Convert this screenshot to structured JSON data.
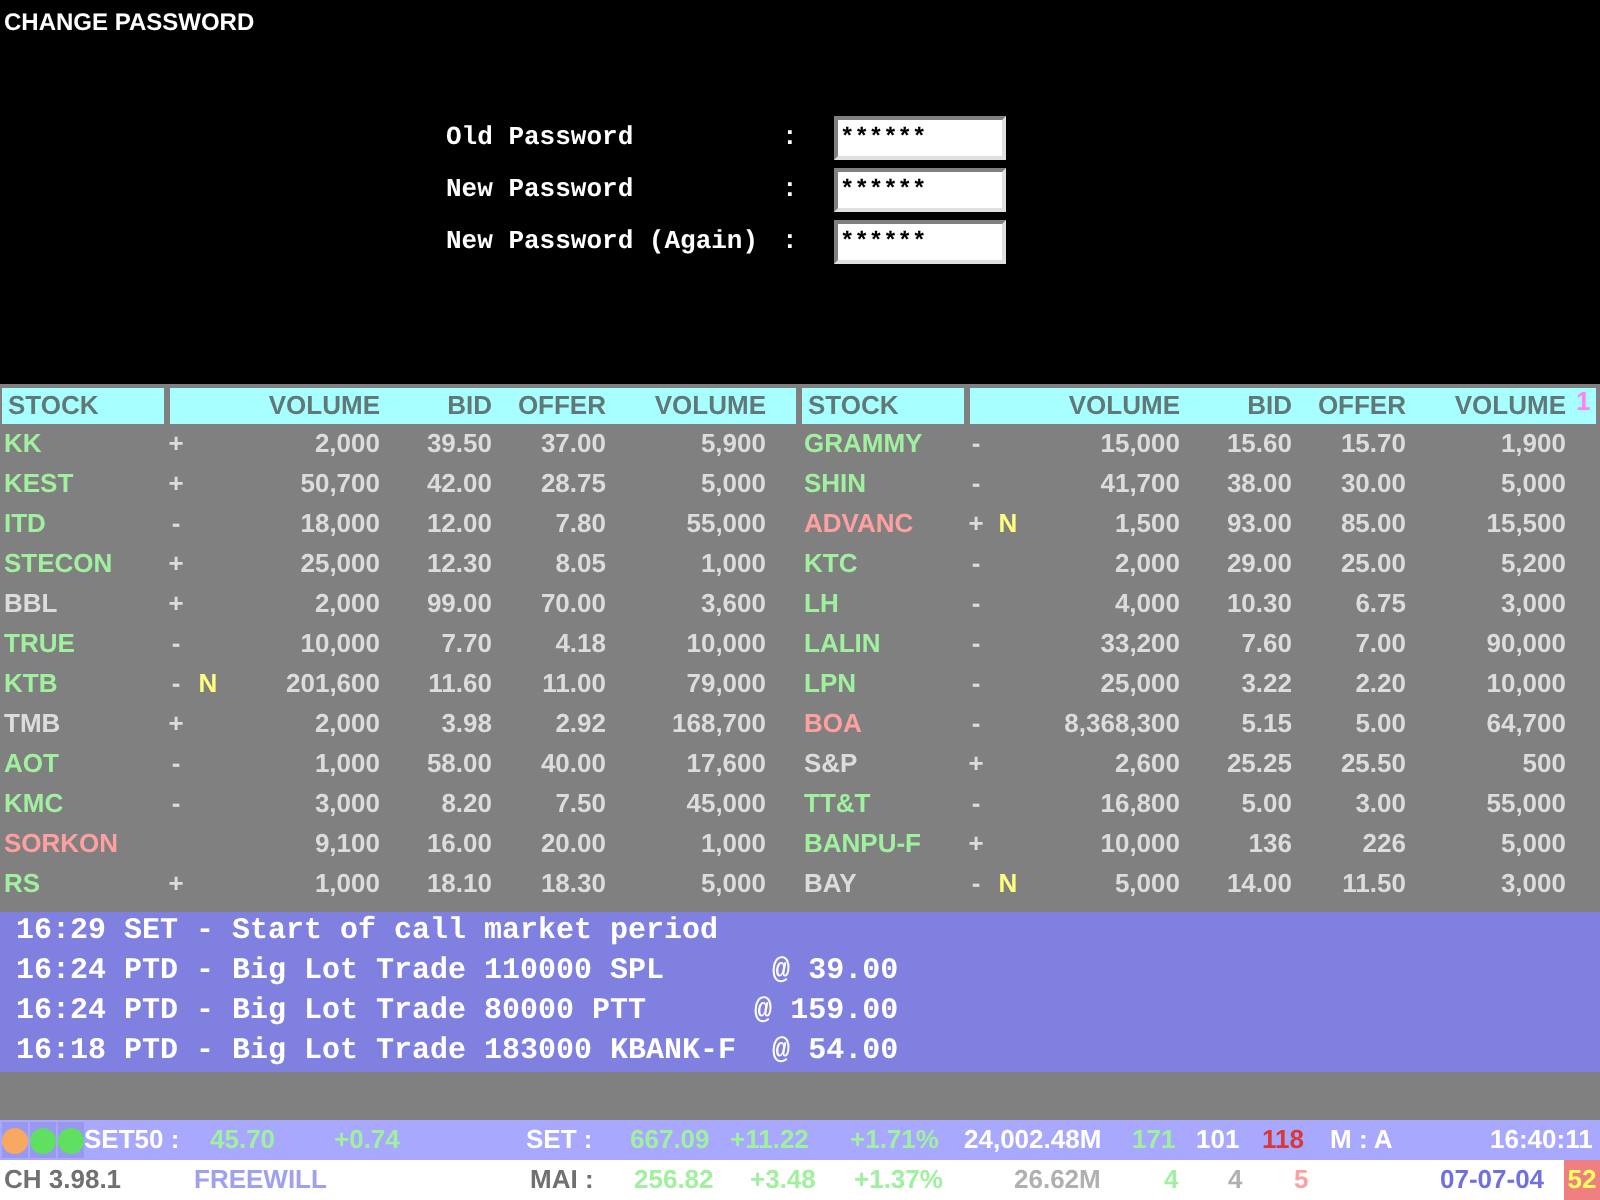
{
  "title": "CHANGE PASSWORD",
  "form": [
    {
      "label": "Old Password",
      "colon": ":",
      "value": "******"
    },
    {
      "label": "New Password",
      "colon": ":",
      "value": "******"
    },
    {
      "label": "New Password (Again)",
      "colon": ":",
      "value": "******"
    }
  ],
  "tables": [
    {
      "columns": [
        "STOCK",
        "VOLUME",
        "BID",
        "OFFER",
        "VOLUME"
      ],
      "rows": [
        {
          "stock": "KK",
          "color": "#a0f0a0",
          "change": "+",
          "volume_1": "2,000",
          "bid": "39.50",
          "offer": "37.00",
          "volume_2": "5,900"
        },
        {
          "stock": "KEST",
          "color": "#a0f0a0",
          "change": "+",
          "volume_1": "50,700",
          "bid": "42.00",
          "offer": "28.75",
          "volume_2": "5,000"
        },
        {
          "stock": "ITD",
          "color": "#a0f0a0",
          "change": "-",
          "volume_1": "18,000",
          "bid": "12.00",
          "offer": "7.80",
          "volume_2": "55,000"
        },
        {
          "stock": "STECON",
          "color": "#a0f0a0",
          "change": "+",
          "volume_1": "25,000",
          "bid": "12.30",
          "offer": "8.05",
          "volume_2": "1,000"
        },
        {
          "stock": "BBL",
          "color": "#dcdcdc",
          "change": "+",
          "volume_1": "2,000",
          "bid": "99.00",
          "offer": "70.00",
          "volume_2": "3,600"
        },
        {
          "stock": "TRUE",
          "color": "#a0f0a0",
          "change": "-",
          "volume_1": "10,000",
          "bid": "7.70",
          "offer": "4.18",
          "volume_2": "10,000"
        },
        {
          "stock": "KTB",
          "color": "#a0f0a0",
          "change": "-",
          "flag": "N",
          "volume_1": "201,600",
          "bid": "11.60",
          "offer": "11.00",
          "volume_2": "79,000"
        },
        {
          "stock": "TMB",
          "color": "#dcdcdc",
          "change": "+",
          "volume_1": "2,000",
          "bid": "3.98",
          "offer": "2.92",
          "volume_2": "168,700"
        },
        {
          "stock": "AOT",
          "color": "#a0f0a0",
          "change": "-",
          "volume_1": "1,000",
          "bid": "58.00",
          "offer": "40.00",
          "volume_2": "17,600"
        },
        {
          "stock": "KMC",
          "color": "#a0f0a0",
          "change": "-",
          "volume_1": "3,000",
          "bid": "8.20",
          "offer": "7.50",
          "volume_2": "45,000"
        },
        {
          "stock": "SORKON",
          "color": "#ffa0a0",
          "volume_1": "9,100",
          "bid": "16.00",
          "offer": "20.00",
          "volume_2": "1,000"
        },
        {
          "stock": "RS",
          "color": "#a0f0a0",
          "change": "+",
          "volume_1": "1,000",
          "bid": "18.10",
          "offer": "18.30",
          "volume_2": "5,000"
        }
      ]
    },
    {
      "columns": [
        "STOCK",
        "VOLUME",
        "BID",
        "OFFER",
        "VOLUME"
      ],
      "marker": "1",
      "rows": [
        {
          "stock": "GRAMMY",
          "color": "#a0f0a0",
          "change": "-",
          "volume_1": "15,000",
          "bid": "15.60",
          "offer": "15.70",
          "volume_2": "1,900"
        },
        {
          "stock": "SHIN",
          "color": "#a0f0a0",
          "change": "-",
          "volume_1": "41,700",
          "bid": "38.00",
          "offer": "30.00",
          "volume_2": "5,000"
        },
        {
          "stock": "ADVANC",
          "color": "#ffa0a0",
          "change": "+",
          "flag": "N",
          "volume_1": "1,500",
          "bid": "93.00",
          "offer": "85.00",
          "volume_2": "15,500"
        },
        {
          "stock": "KTC",
          "color": "#a0f0a0",
          "change": "-",
          "volume_1": "2,000",
          "bid": "29.00",
          "offer": "25.00",
          "volume_2": "5,200"
        },
        {
          "stock": "LH",
          "color": "#a0f0a0",
          "change": "-",
          "volume_1": "4,000",
          "bid": "10.30",
          "offer": "6.75",
          "volume_2": "3,000"
        },
        {
          "stock": "LALIN",
          "color": "#a0f0a0",
          "change": "-",
          "volume_1": "33,200",
          "bid": "7.60",
          "offer": "7.00",
          "volume_2": "90,000"
        },
        {
          "stock": "LPN",
          "color": "#a0f0a0",
          "change": "-",
          "volume_1": "25,000",
          "bid": "3.22",
          "offer": "2.20",
          "volume_2": "10,000"
        },
        {
          "stock": "BOA",
          "color": "#ffa0a0",
          "change": "-",
          "volume_1": "8,368,300",
          "bid": "5.15",
          "offer": "5.00",
          "volume_2": "64,700"
        },
        {
          "stock": "S&P",
          "color": "#dcdcdc",
          "change": "+",
          "volume_1": "2,600",
          "bid": "25.25",
          "offer": "25.50",
          "volume_2": "500"
        },
        {
          "stock": "TT&T",
          "color": "#a0f0a0",
          "change": "-",
          "volume_1": "16,800",
          "bid": "5.00",
          "offer": "3.00",
          "volume_2": "55,000"
        },
        {
          "stock": "BANPU-F",
          "color": "#a0f0a0",
          "change": "+",
          "volume_1": "10,000",
          "bid": "136",
          "offer": "226",
          "volume_2": "5,000"
        },
        {
          "stock": "BAY",
          "color": "#dcdcdc",
          "change": "-",
          "flag": "N",
          "volume_1": "5,000",
          "bid": "14.00",
          "offer": "11.50",
          "volume_2": "3,000"
        }
      ]
    }
  ],
  "news": [
    "16:29 SET - Start of call market period",
    "16:24 PTD - Big Lot Trade 110000 SPL      @ 39.00",
    "16:24 PTD - Big Lot Trade 80000 PTT      @ 159.00",
    "16:18 PTD - Big Lot Trade 183000 KBANK-F  @ 54.00"
  ],
  "status_bar": {
    "lights": [
      {
        "color": "#f8a860"
      },
      {
        "color": "#60e060"
      },
      {
        "color": "#60e060"
      }
    ],
    "items": [
      {
        "text": "SET50 :",
        "color": "#ffffff"
      },
      {
        "text": "45.70",
        "color": "#a0f0a0"
      },
      {
        "text": "+0.74",
        "color": "#a0f0a0"
      },
      {
        "text": "SET :",
        "color": "#ffffff"
      },
      {
        "text": "667.09",
        "color": "#a0f0a0"
      },
      {
        "text": "+11.22",
        "color": "#a0f0a0"
      },
      {
        "text": "+1.71%",
        "color": "#a0f0a0"
      },
      {
        "text": "24,002.48M",
        "color": "#ffffff"
      },
      {
        "text": "171",
        "color": "#a0f0a0"
      },
      {
        "text": "101",
        "color": "#ffffff"
      },
      {
        "text": "118",
        "color": "#d83838"
      },
      {
        "text": "M : A",
        "color": "#ffffff"
      },
      {
        "text": "16:40:11",
        "color": "#ffffff"
      }
    ]
  },
  "status_bar_2": {
    "items": [
      {
        "text": "CH 3.98.1",
        "color": "#707070"
      },
      {
        "text": "FREEWILL",
        "color": "#a0a0f0"
      },
      {
        "text": "MAI :",
        "color": "#707070"
      },
      {
        "text": "256.82",
        "color": "#a0f0a0"
      },
      {
        "text": "+3.48",
        "color": "#a0f0a0"
      },
      {
        "text": "+1.37%",
        "color": "#a0f0a0"
      },
      {
        "text": "26.62M",
        "color": "#b0b0b0"
      },
      {
        "text": "4",
        "color": "#a0f0a0"
      },
      {
        "text": "4",
        "color": "#b0b0b0"
      },
      {
        "text": "5",
        "color": "#ffa0a0"
      },
      {
        "text": "07-07-04",
        "color": "#7070e0"
      }
    ],
    "badge": "52"
  }
}
